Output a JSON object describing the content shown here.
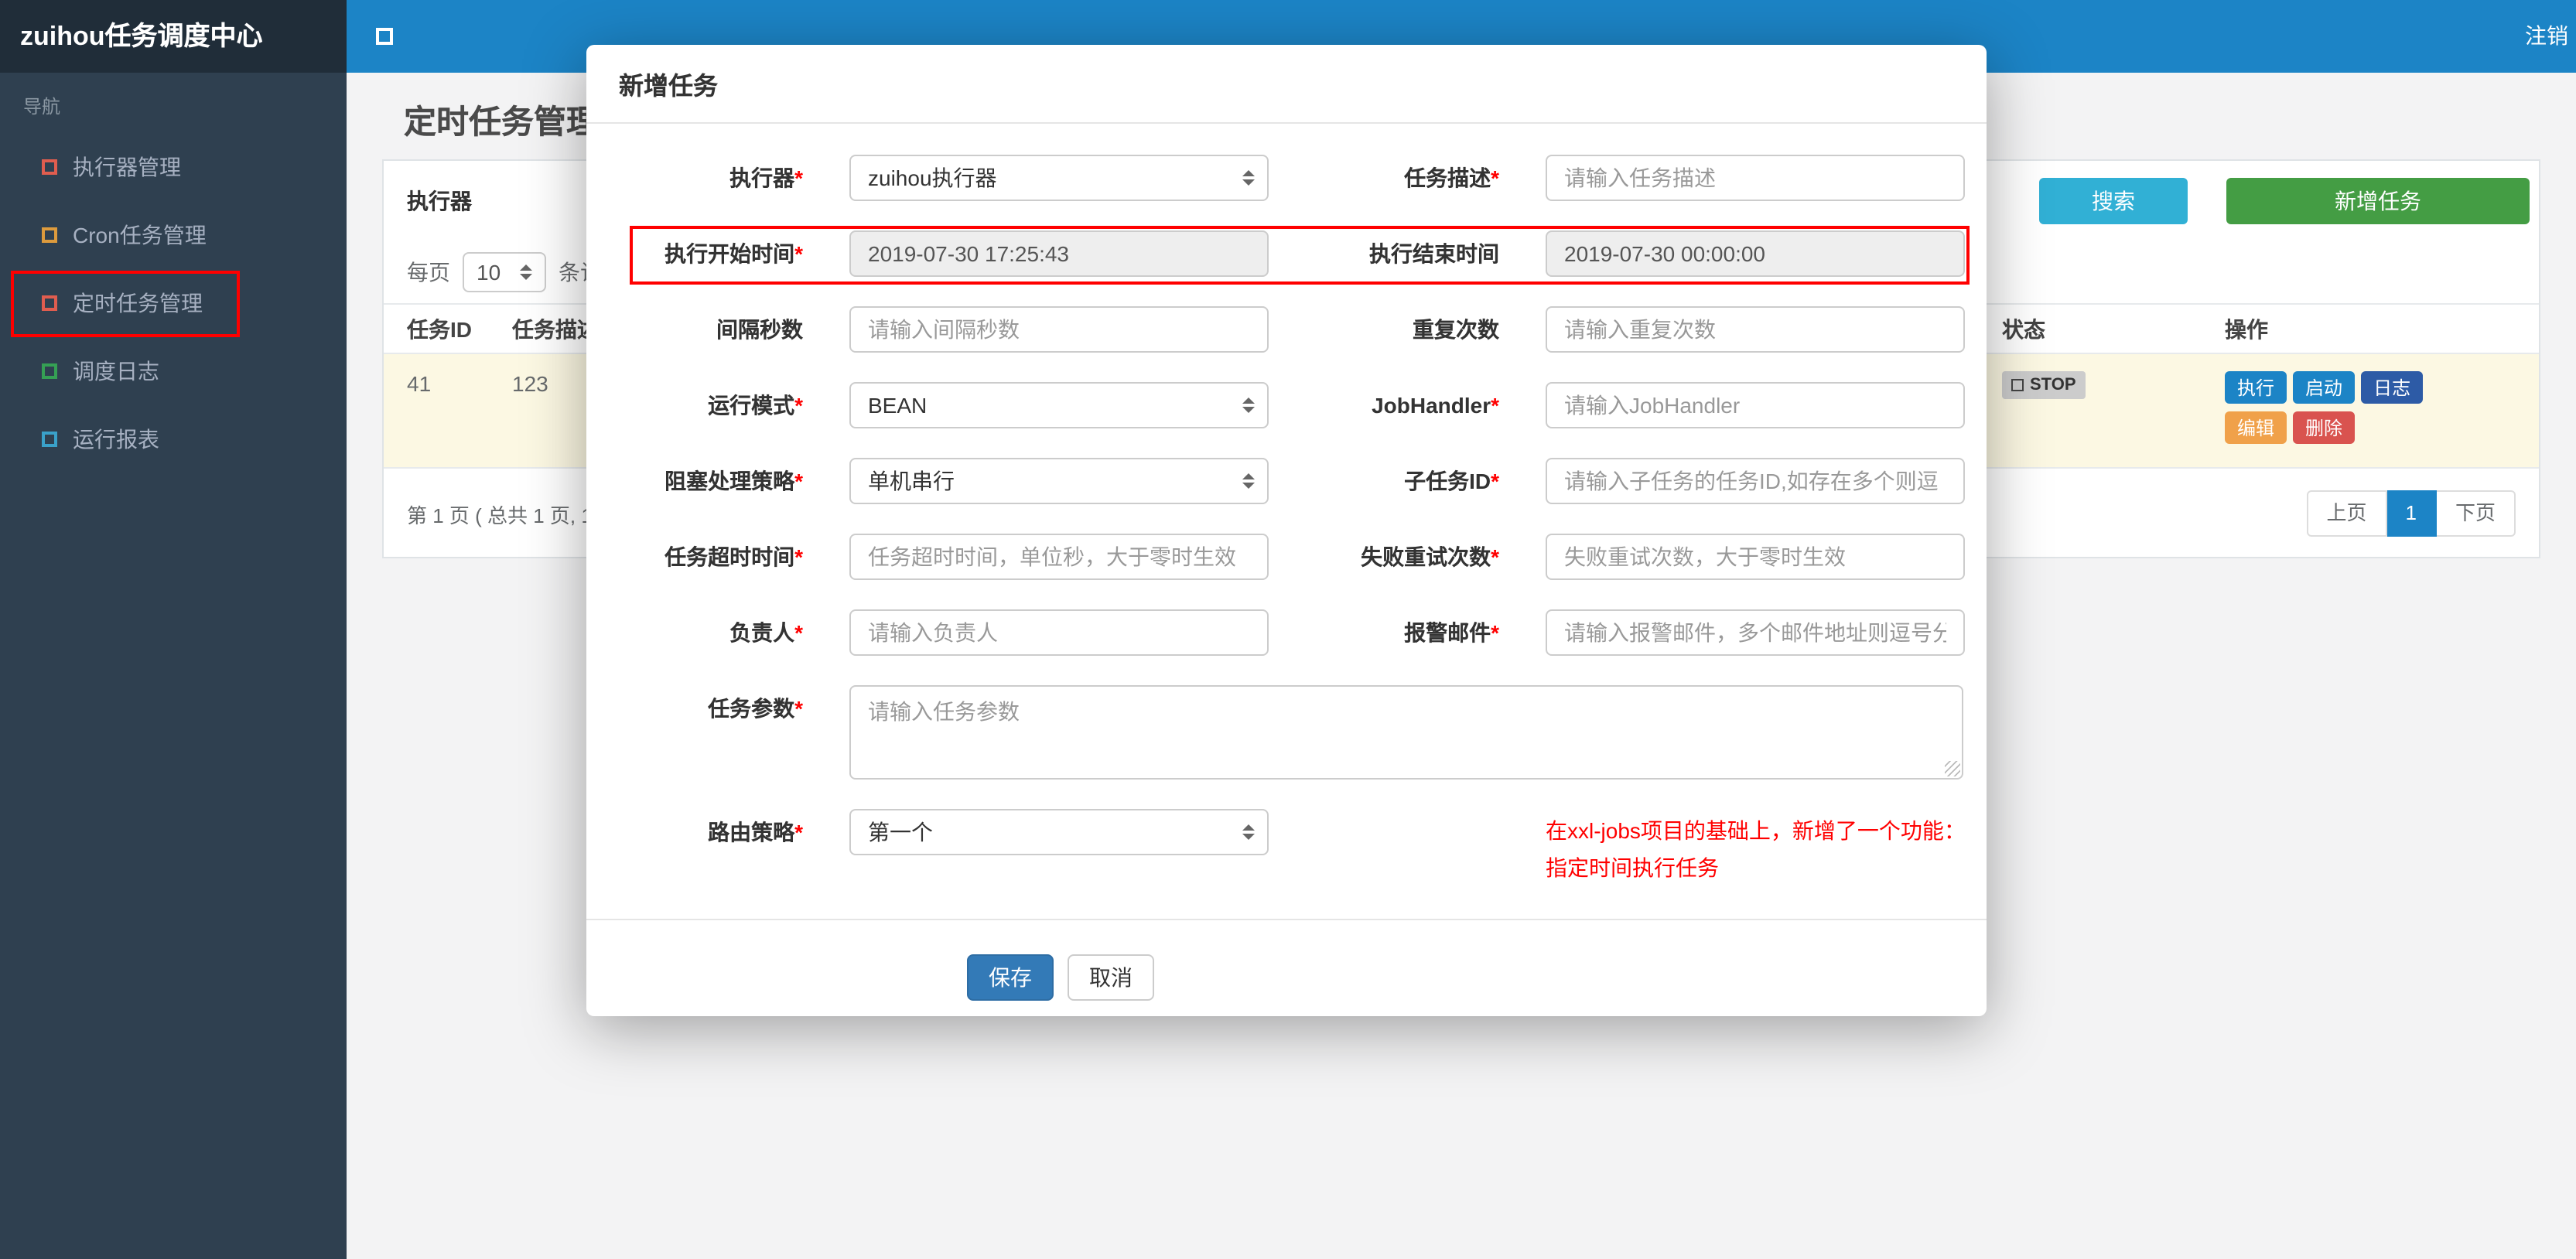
{
  "colors": {
    "topbar": "#1c84c6",
    "brand_bg": "#202d39",
    "sidebar": "#2f4050",
    "annotation": "#ff0000",
    "search_button": "#31b0d5",
    "add_button": "#449d44",
    "save_button": "#337ab7",
    "action_exec": "#1c84c6",
    "action_start": "#1c84c6",
    "action_log": "#2d5ba6",
    "action_edit": "#f0a14a",
    "action_delete": "#d9534f",
    "status_badge_bg": "#cccccc",
    "highlight_row_bg": "#fcf8e3"
  },
  "topbar": {
    "brand": "zuihou任务调度中心",
    "logout": "注销"
  },
  "sidebar": {
    "section_label": "导航",
    "items": [
      {
        "label": "执行器管理",
        "icon_color": "#e05d4f"
      },
      {
        "label": "Cron任务管理",
        "icon_color": "#dd9b3d"
      },
      {
        "label": "定时任务管理",
        "icon_color": "#e05d4f"
      },
      {
        "label": "调度日志",
        "icon_color": "#35a054"
      },
      {
        "label": "运行报表",
        "icon_color": "#3aa1c9"
      }
    ]
  },
  "page": {
    "title": "定时任务管理",
    "filter": {
      "executor_label": "执行器",
      "search": "搜索",
      "add": "新增任务"
    },
    "per_page": {
      "label": "每页",
      "size": "10",
      "suffix": "条记"
    },
    "table": {
      "headers": {
        "id": "任务ID",
        "desc": "任务描述",
        "status": "状态",
        "ops": "操作"
      },
      "row": {
        "id": "41",
        "desc": "123",
        "status": "STOP",
        "actions": {
          "exec": "执行",
          "start": "启动",
          "log": "日志",
          "edit": "编辑",
          "del": "删除"
        }
      }
    },
    "pagination": {
      "summary": "第 1 页 ( 总共 1 页, 1",
      "prev": "上页",
      "current": "1",
      "next": "下页"
    }
  },
  "modal": {
    "title": "新增任务",
    "rows": [
      {
        "left": {
          "label": "执行器",
          "req": "*",
          "value": "zuihou执行器"
        },
        "right": {
          "label": "任务描述",
          "req": "*",
          "placeholder": "请输入任务描述"
        }
      },
      {
        "left": {
          "label": "执行开始时间",
          "req": "*",
          "value": "2019-07-30 17:25:43"
        },
        "right": {
          "label": "执行结束时间",
          "req": "",
          "value": "2019-07-30 00:00:00"
        }
      },
      {
        "left": {
          "label": "间隔秒数",
          "req": "",
          "placeholder": "请输入间隔秒数"
        },
        "right": {
          "label": "重复次数",
          "req": "",
          "placeholder": "请输入重复次数"
        }
      },
      {
        "left": {
          "label": "运行模式",
          "req": "*",
          "value": "BEAN"
        },
        "right": {
          "label": "JobHandler",
          "req": "*",
          "placeholder": "请输入JobHandler"
        }
      },
      {
        "left": {
          "label": "阻塞处理策略",
          "req": "*",
          "value": "单机串行"
        },
        "right": {
          "label": "子任务ID",
          "req": "*",
          "placeholder": "请输入子任务的任务ID,如存在多个则逗"
        }
      },
      {
        "left": {
          "label": "任务超时时间",
          "req": "*",
          "placeholder": "任务超时时间，单位秒，大于零时生效"
        },
        "right": {
          "label": "失败重试次数",
          "req": "*",
          "placeholder": "失败重试次数，大于零时生效"
        }
      },
      {
        "left": {
          "label": "负责人",
          "req": "*",
          "placeholder": "请输入负责人"
        },
        "right": {
          "label": "报警邮件",
          "req": "*",
          "placeholder": "请输入报警邮件，多个邮件地址则逗号分"
        }
      }
    ],
    "param": {
      "label": "任务参数",
      "req": "*",
      "placeholder": "请输入任务参数"
    },
    "route": {
      "label": "路由策略",
      "req": "*",
      "value": "第一个"
    },
    "note_line1": "在xxl-jobs项目的基础上，新增了一个功能：",
    "note_line2": "指定时间执行任务",
    "save": "保存",
    "cancel": "取消"
  }
}
